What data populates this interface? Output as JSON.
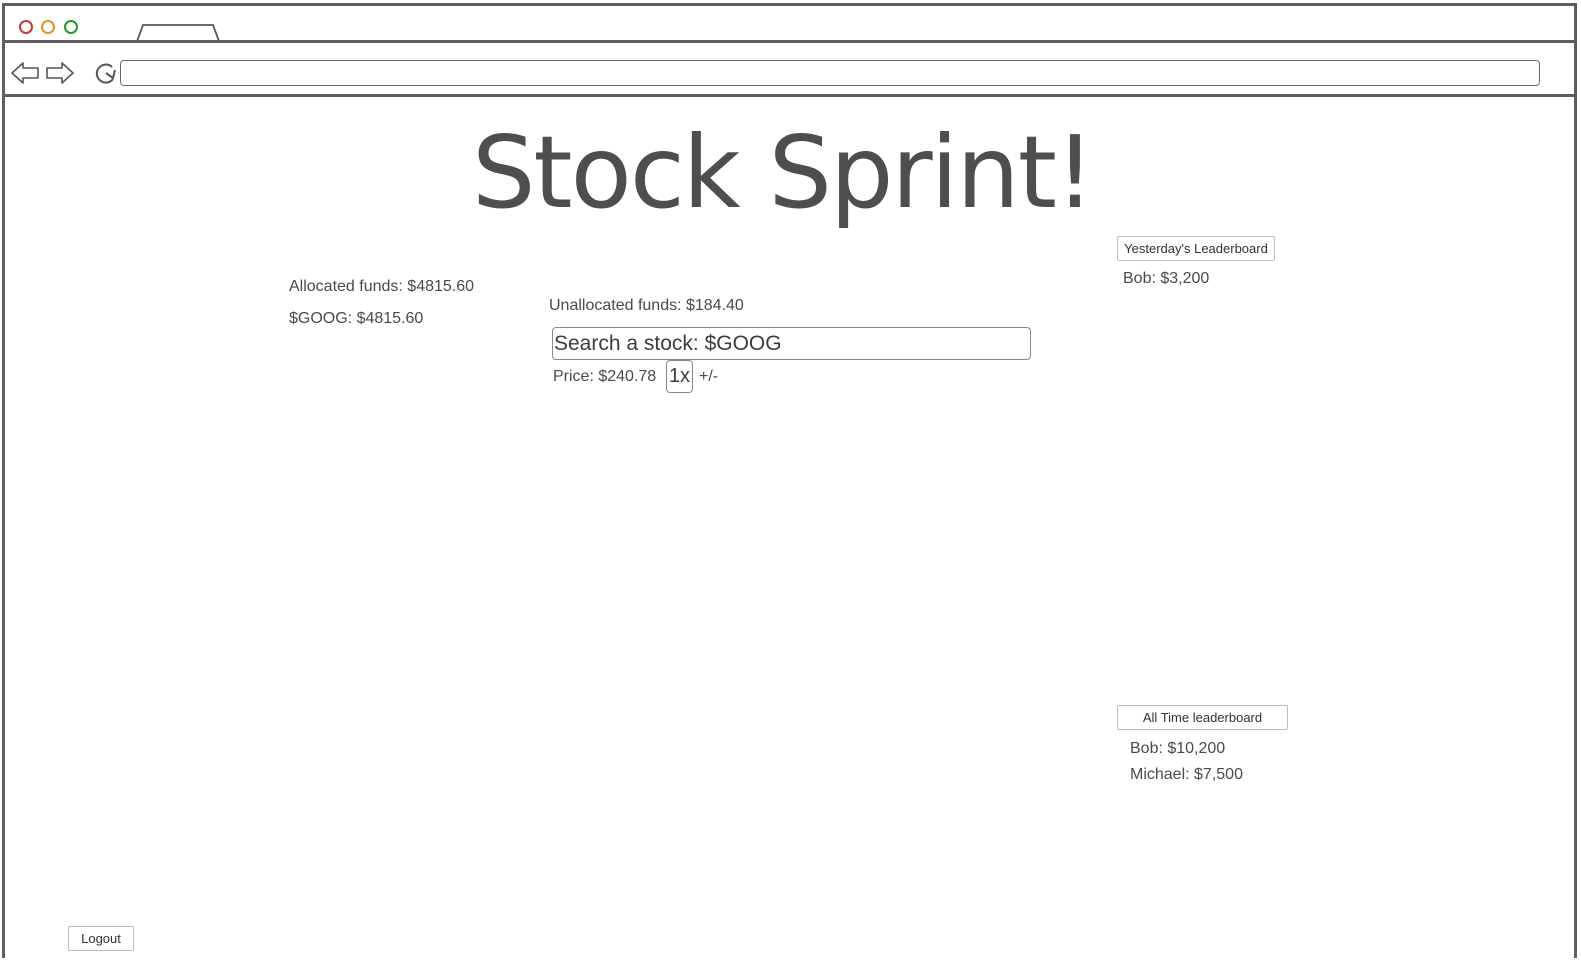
{
  "browser": {
    "url": "",
    "window_controls": [
      "close",
      "minimize",
      "maximize"
    ],
    "icons": [
      "back-arrow-icon",
      "forward-arrow-icon",
      "refresh-icon"
    ]
  },
  "page": {
    "title": "Stock Sprint!"
  },
  "portfolio": {
    "allocated_label": "Allocated funds: $4815.60",
    "holdings": [
      {
        "text": "$GOOG: $4815.60"
      }
    ]
  },
  "trade": {
    "unallocated_label": "Unallocated funds: $184.40",
    "search_value": "Search a stock: $GOOG",
    "price_label": "Price: $240.78",
    "multiplier_label": "1x",
    "adjust_label": "+/-"
  },
  "leaderboards": {
    "yesterday": {
      "button_label": "Yesterday's Leaderboard",
      "entries": [
        "Bob: $3,200"
      ]
    },
    "all_time": {
      "button_label": "All Time leaderboard",
      "entries": [
        "Bob: $10,200",
        "Michael: $7,500"
      ]
    }
  },
  "footer": {
    "logout_label": "Logout"
  }
}
